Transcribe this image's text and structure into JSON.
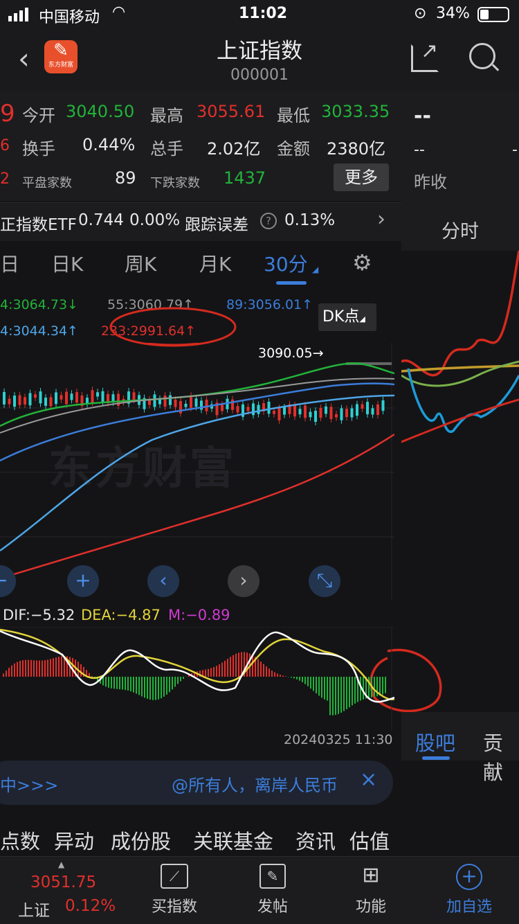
{
  "status": {
    "carrier": "中国移动",
    "time": "11:02",
    "battery": "34%"
  },
  "nav": {
    "title": "上证指数",
    "code": "000001",
    "logo_text": "东方财富"
  },
  "quote": {
    "open_label": "今开",
    "open": "3040.50",
    "high_label": "最高",
    "high": "3055.61",
    "low_label": "最低",
    "low": "3033.35",
    "turnover_label": "换手",
    "turnover": "0.44%",
    "volume_label": "总手",
    "volume": "2.02亿",
    "amount_label": "金额",
    "amount": "2380亿",
    "flat_label": "平盘家数",
    "flat": "89",
    "down_label": "下跌家数",
    "down": "1437",
    "more_button": "更多",
    "side_top": "9",
    "side_mid": "6",
    "side_low": "2"
  },
  "right_panel": {
    "dashes": "--",
    "dashes2": "--",
    "dash3": "-",
    "prev_close": "昨收",
    "tab_fenshi": "分时",
    "tab_guba": "股吧",
    "tab_gongxian": "贡献"
  },
  "etf": {
    "label": "正指数ETF",
    "price": "0.744",
    "change": "0.00%",
    "tracking_label": "跟踪误差",
    "tracking": "0.13%"
  },
  "tabs": {
    "t0": "日",
    "t1": "日K",
    "t2": "周K",
    "t3": "月K",
    "t4": "30分"
  },
  "ma": {
    "ma_a": "4:3064.73↓",
    "ma_b": "55:3060.79↑",
    "ma_c": "89:3056.01↑",
    "ma_d": "4:3044.34↑",
    "ma_e": "233:2991.64↑"
  },
  "chart": {
    "dk_label": "DK点",
    "peak_label": "3090.05→",
    "watermark": "东方财富"
  },
  "controls": {
    "minus": "−",
    "plus": "+",
    "left": "‹",
    "right": "›",
    "expand": "⤡"
  },
  "macd": {
    "dif": "DIF:−5.32",
    "dea": "DEA:−4.87",
    "m": "M:−0.89",
    "timestamp": "20240325 11:30"
  },
  "notice": {
    "left": "中>>>",
    "text": "@所有人，离岸人民币",
    "close": "×"
  },
  "subtabs": [
    "点数",
    "异动",
    "成份股",
    "关联基金",
    "资讯",
    "估值"
  ],
  "bottom": {
    "index_price": "3051.75",
    "index_name": "上证",
    "index_change": "0.12%",
    "buy": "买指数",
    "post": "发帖",
    "func": "功能",
    "add": "加自选"
  },
  "colors": {
    "green": "#22b33a",
    "red": "#e0302c",
    "blue": "#3c7ddb"
  }
}
